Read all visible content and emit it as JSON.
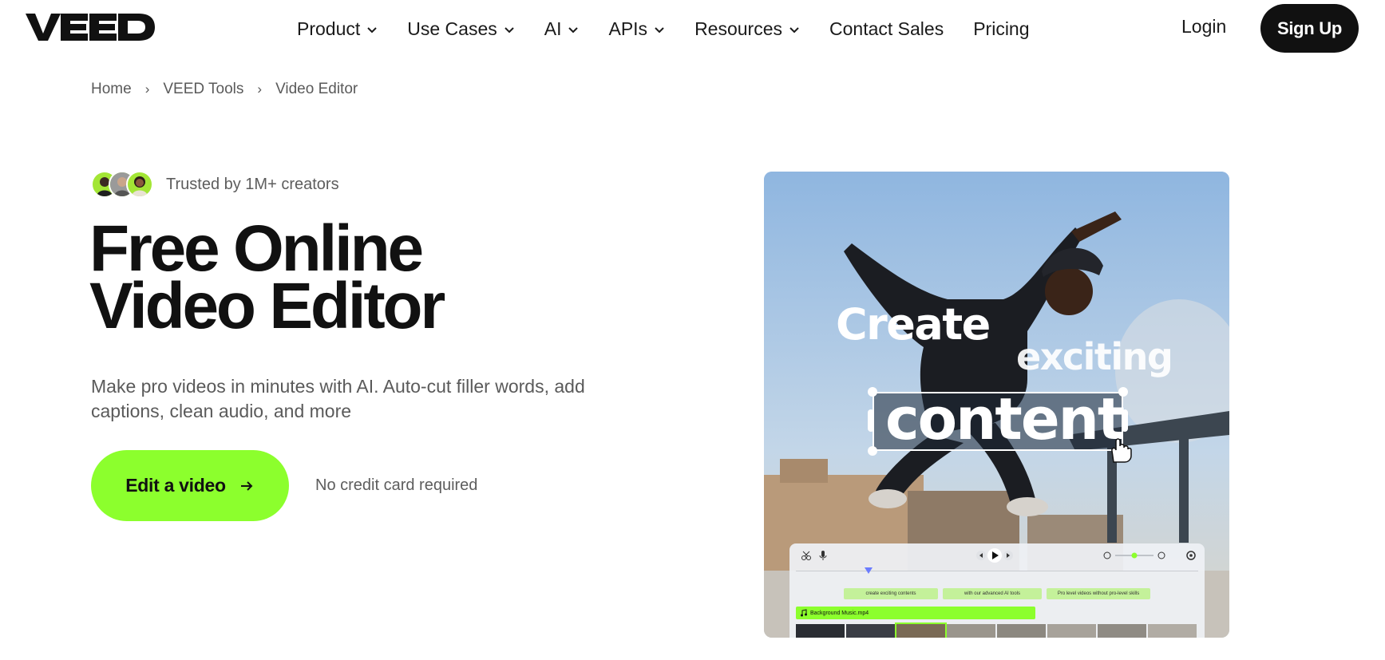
{
  "header": {
    "logo_alt": "VEED",
    "nav": [
      {
        "label": "Product",
        "has_dropdown": true
      },
      {
        "label": "Use Cases",
        "has_dropdown": true
      },
      {
        "label": "AI",
        "has_dropdown": true
      },
      {
        "label": "APIs",
        "has_dropdown": true
      },
      {
        "label": "Resources",
        "has_dropdown": true
      },
      {
        "label": "Contact Sales",
        "has_dropdown": false
      },
      {
        "label": "Pricing",
        "has_dropdown": false
      }
    ],
    "login_label": "Login",
    "signup_label": "Sign Up"
  },
  "breadcrumb": {
    "items": [
      "Home",
      "VEED Tools",
      "Video Editor"
    ],
    "separator": "›"
  },
  "hero": {
    "trust_text": "Trusted by 1M+ creators",
    "title_line1": "Free Online",
    "title_line2": "Video Editor",
    "subtitle": "Make pro videos in minutes with AI. Auto-cut filler words, add captions, clean audio, and more",
    "cta_label": "Edit a video",
    "cta_note": "No credit card required"
  },
  "media": {
    "overlay_word1": "Create",
    "overlay_word2": "exciting",
    "overlay_word3": "content",
    "timeline": {
      "clips": [
        "create exciting contents",
        "with our advanced AI tools",
        "Pro level videos without pro-level skills"
      ],
      "audio_track": "Background Music.mp4"
    }
  },
  "colors": {
    "accent_green": "#8cff2d",
    "dark": "#111111",
    "muted_text": "#5a5a5a"
  },
  "icons": [
    "veed-logo",
    "chevron-down-icon",
    "arrow-right-icon",
    "cursor-hand-icon",
    "scissors-icon",
    "mic-icon",
    "play-icon",
    "zoom-icon",
    "settings-icon",
    "music-note-icon"
  ]
}
